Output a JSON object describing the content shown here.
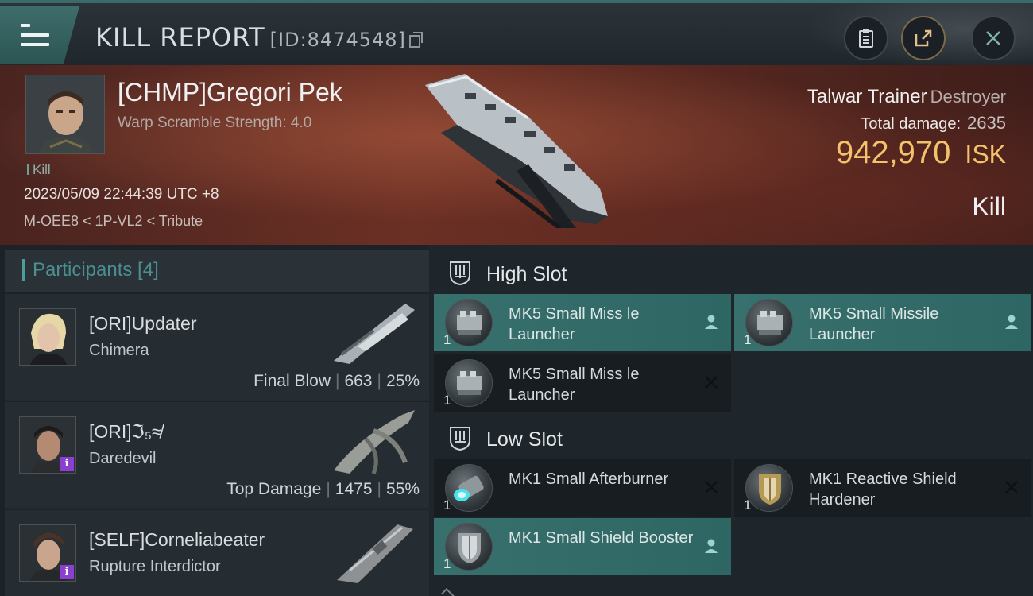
{
  "header": {
    "title": "KILL REPORT",
    "report_id": "[ID:8474548]",
    "menu_icon": "hamburger-icon",
    "buttons": [
      {
        "name": "clipboard-icon"
      },
      {
        "name": "share-icon"
      },
      {
        "name": "close-icon"
      }
    ]
  },
  "victim": {
    "name": "[CHMP]Gregori Pek",
    "subtitle": "Warp Scramble Strength: 4.0",
    "tag": "Kill",
    "datetime": "2023/05/09 22:44:39 UTC +8",
    "location": "M-OEE8 < 1P-VL2 < Tribute",
    "ship_name": "Talwar Trainer",
    "ship_class": "Destroyer",
    "damage_label": "Total damage:",
    "damage_value": "2635",
    "isk_value": "942,970",
    "isk_unit": "ISK",
    "result": "Kill"
  },
  "participants": {
    "header": "Participants [4]",
    "rows": [
      {
        "name": "[ORI]Updater",
        "ship": "Chimera",
        "role": "Final Blow",
        "damage": "663",
        "percent": "25%",
        "badge": false
      },
      {
        "name": "[ORI]ℑ₅≉",
        "ship": "Daredevil",
        "role": "Top Damage",
        "damage": "1475",
        "percent": "55%",
        "badge": true
      },
      {
        "name": "[SELF]Corneliabeater",
        "ship": "Rupture Interdictor",
        "role": "",
        "damage": "",
        "percent": "",
        "badge": true
      }
    ]
  },
  "slots": {
    "high": {
      "label": "High Slot",
      "items": [
        {
          "name": "MK5 Small Miss le Launcher",
          "qty": "1",
          "status": "dropped",
          "icon": "missile-launcher-icon"
        },
        {
          "name": "MK5 Small Missile Launcher",
          "qty": "1",
          "status": "dropped",
          "icon": "missile-launcher-icon"
        },
        {
          "name": "MK5 Small Miss le Launcher",
          "qty": "1",
          "status": "destroyed",
          "icon": "missile-launcher-icon"
        }
      ]
    },
    "low": {
      "label": "Low Slot",
      "items": [
        {
          "name": "MK1 Small Afterburner",
          "qty": "1",
          "status": "destroyed",
          "icon": "afterburner-icon"
        },
        {
          "name": "MK1 Reactive Shield Hardener",
          "qty": "1",
          "status": "destroyed",
          "icon": "shield-hardener-icon"
        },
        {
          "name": "MK1 Small Shield Booster",
          "qty": "1",
          "status": "dropped",
          "icon": "shield-booster-icon"
        }
      ]
    }
  },
  "colors": {
    "accent_teal": "#37706d",
    "isk_gold": "#f3c26a",
    "badge_purple": "#8b3fd1"
  }
}
